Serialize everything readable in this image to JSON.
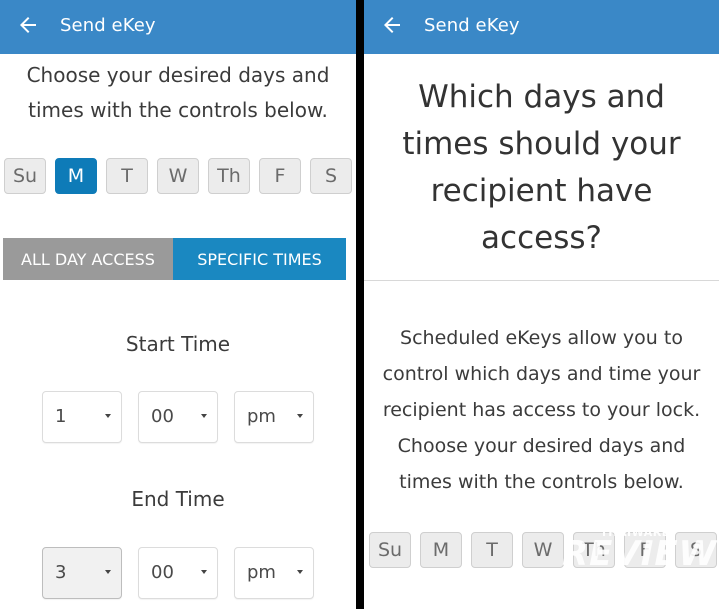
{
  "left": {
    "appbar": {
      "title": "Send eKey"
    },
    "instruction": [
      "Choose your desired days and",
      "times with the controls below."
    ],
    "days": [
      "Su",
      "M",
      "T",
      "W",
      "Th",
      "F",
      "S"
    ],
    "selected_day": "M",
    "access_toggle": {
      "all_day": "ALL DAY ACCESS",
      "specific": "SPECIFIC TIMES",
      "selected": "SPECIFIC TIMES"
    },
    "start_time": {
      "label": "Start Time",
      "hour": "1",
      "minute": "00",
      "ampm": "pm"
    },
    "end_time": {
      "label": "End Time",
      "hour": "3",
      "minute": "00",
      "ampm": "pm"
    }
  },
  "right": {
    "appbar": {
      "title": "Send eKey"
    },
    "heading": [
      "Which days and",
      "times should your",
      "recipient have",
      "access?"
    ],
    "body": [
      "Scheduled eKeys allow you to",
      "control which days and time your",
      "recipient has access to your lock.",
      "Choose your desired days and",
      "times with the controls below."
    ],
    "days": [
      "Su",
      "M",
      "T",
      "W",
      "Th",
      "F",
      "S"
    ]
  },
  "watermark": {
    "small": "THAIWARE",
    "big": "REVIEW"
  },
  "colors": {
    "appbar": "#3a88c7",
    "selected": "#0e7bb8",
    "segment_active": "#1a88c1",
    "segment_inactive": "#9a9a9a"
  },
  "icons": {
    "back": "arrow-left-icon",
    "dropdown": "caret-down-icon"
  }
}
